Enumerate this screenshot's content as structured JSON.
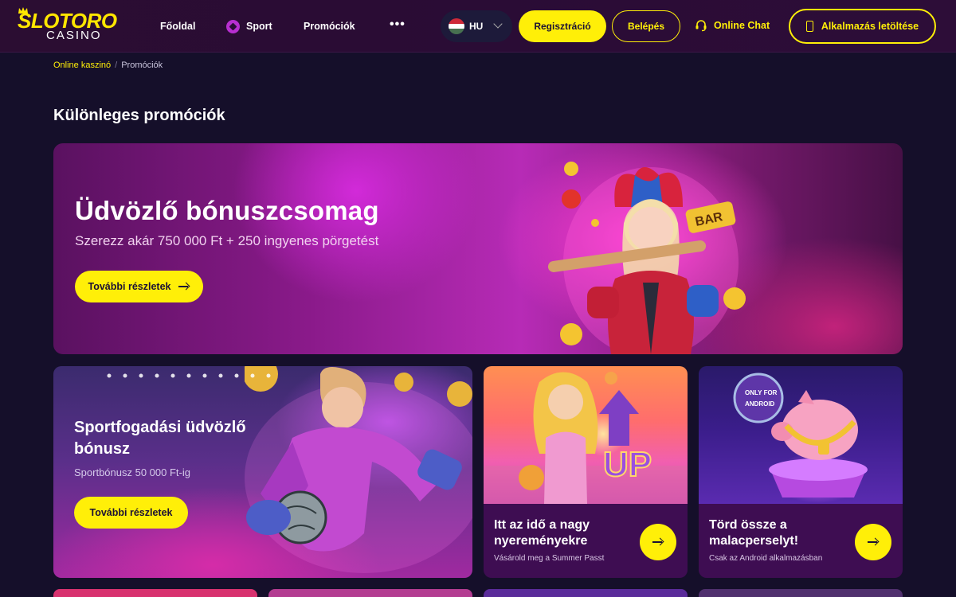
{
  "header": {
    "logo_main": "SLOTORO",
    "logo_sub": "CASINO",
    "nav": {
      "home": "Főoldal",
      "sport": "Sport",
      "promotions": "Promóciók",
      "more": "•••"
    },
    "language": "HU",
    "register_label": "Regisztráció",
    "login_label": "Belépés",
    "chat_label": "Online Chat",
    "app_label": "Alkalmazás letöltése"
  },
  "breadcrumb": {
    "home": "Online kaszinó",
    "separator": "/",
    "current": "Promóciók"
  },
  "page_title": "Különleges promóciók",
  "hero": {
    "title": "Üdvözlő bónuszcsomag",
    "subtitle": "Szerezz akár 750 000 Ft + 250 ingyenes pörgetést",
    "button_label": "További részletek"
  },
  "cards": [
    {
      "title": "Sportfogadási üdvözlő bónusz",
      "subtitle": "Sportbónusz 50 000 Ft-ig",
      "button_label": "További részletek"
    },
    {
      "title": "Itt az idő a nagy nyereményekre",
      "subtitle": "Vásárold meg a Summer Passt"
    },
    {
      "title": "Törd össze a malacperselyt!",
      "subtitle": "Csak az Android alkalmazásban"
    }
  ],
  "colors": {
    "accent": "#ffef08",
    "background": "#150f2a",
    "header": "#2a0c35",
    "card_footer": "#3e0d52"
  },
  "icons": {
    "sport": "soccer-ball-icon",
    "chat": "headset-icon",
    "app": "phone-icon",
    "arrow": "arrow-right-icon",
    "language": "chevron-down-icon"
  }
}
